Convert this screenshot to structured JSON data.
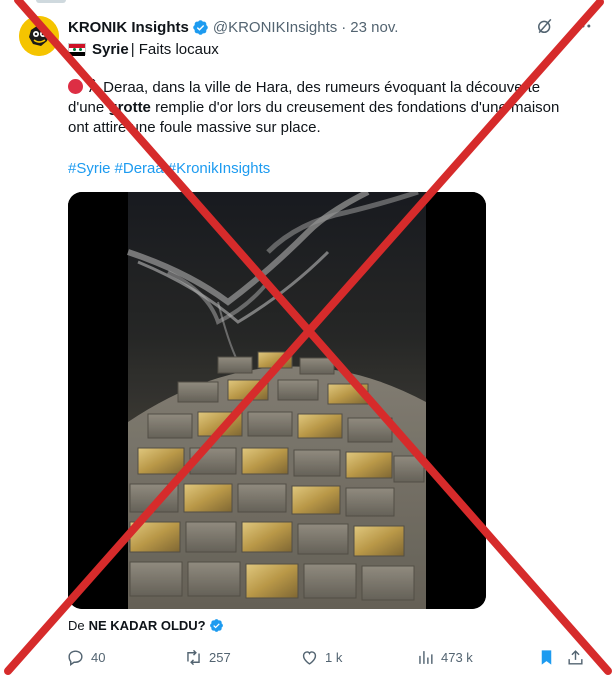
{
  "post": {
    "author_name": "KRONIK Insights",
    "handle": "@KRONIKInsights",
    "separator": "·",
    "date": "23 nov.",
    "subtitle_bold": "Syrie",
    "subtitle_rest": "| Faits locaux",
    "body_line1_text": "À Deraa, dans la ville de Hara, des rumeurs évoquant la découverte",
    "body_line2_pre": "d'une ",
    "body_line2_bold": "grotte",
    "body_line2_post": " remplie d'or lors du creusement des fondations d'une maison",
    "body_line3": "ont attiré une foule massive sur place.",
    "hashtags": [
      "#Syrie",
      "#Deraa",
      "#KronikInsights"
    ],
    "source_prefix": "De",
    "source_name": "NE KADAR OLDU?"
  },
  "actions": {
    "replies": "40",
    "reposts": "257",
    "likes": "1 k",
    "views": "473 k"
  },
  "colors": {
    "accent": "#1d9bf0",
    "muted": "#536471",
    "cross": "#d62b2b",
    "bookmark_active": "#1d9bf0"
  },
  "icons": {
    "verified": "verified-badge-icon",
    "reply": "reply-icon",
    "repost": "repost-icon",
    "like": "heart-icon",
    "views": "views-bar-icon",
    "bookmark": "bookmark-icon",
    "share": "share-icon",
    "grok": "grok-icon",
    "more": "more-dots-icon"
  }
}
